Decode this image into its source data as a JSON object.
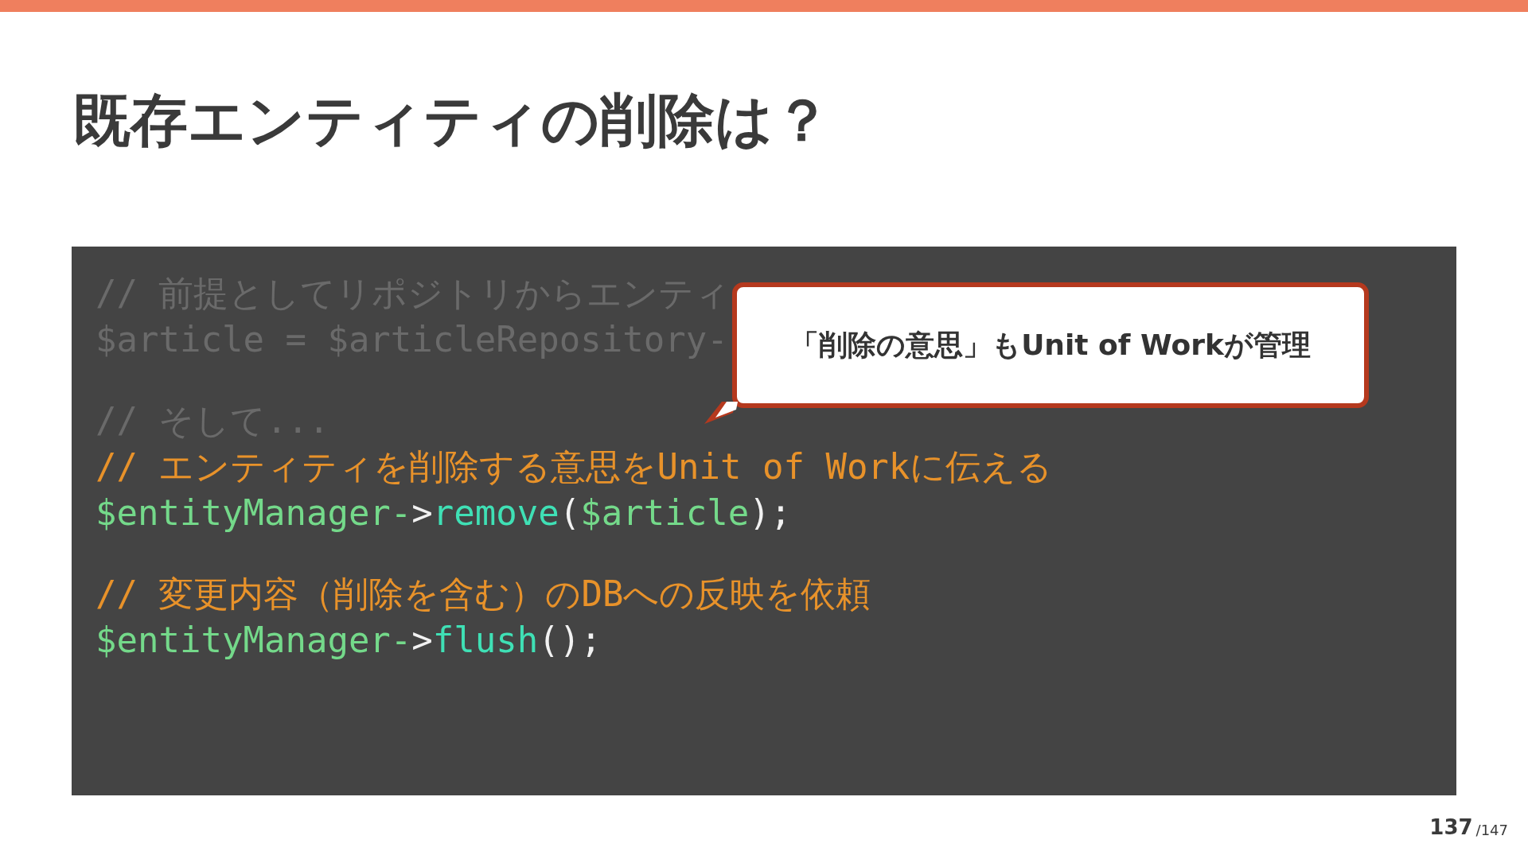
{
  "title": "既存エンティティの削除は？",
  "code_blocks": [
    {
      "lines": [
        {
          "faded": true,
          "tokens": [
            {
              "text": "// 前提としてリポジトリからエンティ"
            }
          ]
        },
        {
          "faded": true,
          "tokens": [
            {
              "text": "$article = $articleRepository-"
            }
          ]
        }
      ]
    },
    {
      "lines": [
        {
          "faded": true,
          "tokens": [
            {
              "text": "// そして..."
            }
          ]
        },
        {
          "faded": false,
          "tokens": [
            {
              "kind": "comment",
              "text": "// エンティティを削除する意思をUnit of Workに伝える"
            }
          ]
        },
        {
          "faded": false,
          "tokens": [
            {
              "kind": "variable",
              "text": "$entityManager-"
            },
            {
              "kind": "punct",
              "text": ">"
            },
            {
              "kind": "method",
              "text": "remove"
            },
            {
              "kind": "punct",
              "text": "("
            },
            {
              "kind": "variable",
              "text": "$article"
            },
            {
              "kind": "punct",
              "text": ");"
            }
          ]
        }
      ]
    },
    {
      "lines": [
        {
          "faded": false,
          "tokens": [
            {
              "kind": "comment",
              "text": "// 変更内容（削除を含む）のDBへの反映を依頼"
            }
          ]
        },
        {
          "faded": false,
          "tokens": [
            {
              "kind": "variable",
              "text": "$entityManager-"
            },
            {
              "kind": "punct",
              "text": ">"
            },
            {
              "kind": "method",
              "text": "flush"
            },
            {
              "kind": "punct",
              "text": "();"
            }
          ]
        }
      ]
    }
  ],
  "callout": "「削除の意思」もUnit of Workが管理",
  "page": {
    "current": "137",
    "total": "/147"
  }
}
